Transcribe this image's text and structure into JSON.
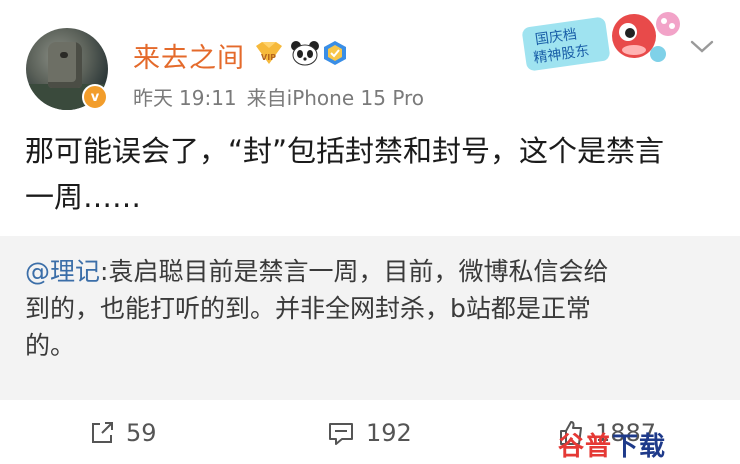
{
  "user": {
    "name": "来去之间",
    "avatar_badge": "v",
    "icons": [
      "vip-badge-icon",
      "panda-icon",
      "verified-shield-icon"
    ]
  },
  "meta": {
    "day": "昨天",
    "time": "19:11",
    "source": "来自iPhone 15 Pro"
  },
  "sticker": {
    "text_line1": "国庆档",
    "text_line2": "精神股东"
  },
  "post": {
    "lines": [
      "那可能误会了，“封”包括封禁和封号，这个是禁言",
      "一周……"
    ]
  },
  "repost": {
    "mention": "@理记",
    "line1_rest": ":袁启聪目前是禁言一周，目前，微博私信会给",
    "line2": "到的，也能打听的到。并非全网封杀，b站都是正常",
    "line3": "的。"
  },
  "actions": {
    "share_count": "59",
    "comment_count": "192",
    "like_count": "1887"
  },
  "watermark": {
    "part1": "谷普",
    "part2": "下载"
  },
  "colors": {
    "username": "#e46a2b",
    "mention": "#3b6ea8",
    "repost_bg": "#f3f3f3",
    "meta": "#7a7a7a"
  }
}
